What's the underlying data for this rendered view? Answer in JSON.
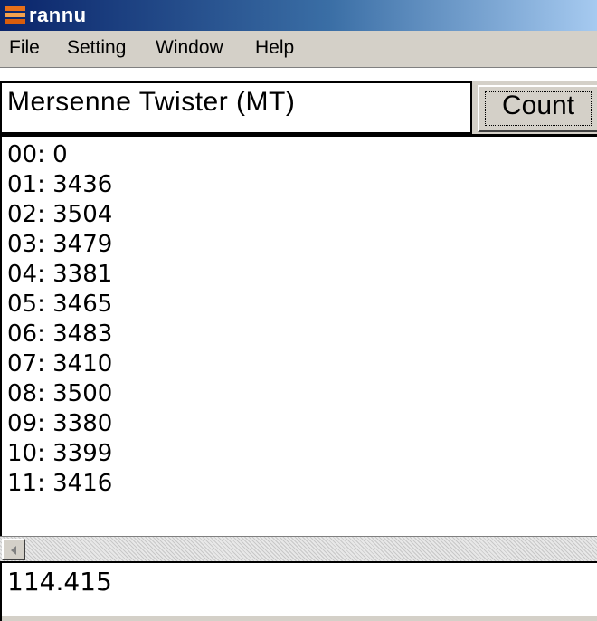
{
  "window": {
    "title": "rannu"
  },
  "menu": {
    "items": [
      "File",
      "Setting",
      "Window",
      "Help"
    ]
  },
  "header": {
    "algorithm": "Mersenne Twister (MT)",
    "count_label": "Count"
  },
  "results": {
    "lines": [
      "00: 0",
      "01: 3436",
      "02: 3504",
      "03: 3479",
      "04: 3381",
      "05: 3465",
      "06: 3483",
      "07: 3410",
      "08: 3500",
      "09: 3380",
      "10: 3399",
      "11: 3416"
    ]
  },
  "status": {
    "value": "114.415"
  },
  "colors": {
    "titlebar_start": "#0a246a",
    "titlebar_end": "#a6caf0",
    "chrome": "#d4d0c8",
    "icon_orange": "#e8701a"
  }
}
